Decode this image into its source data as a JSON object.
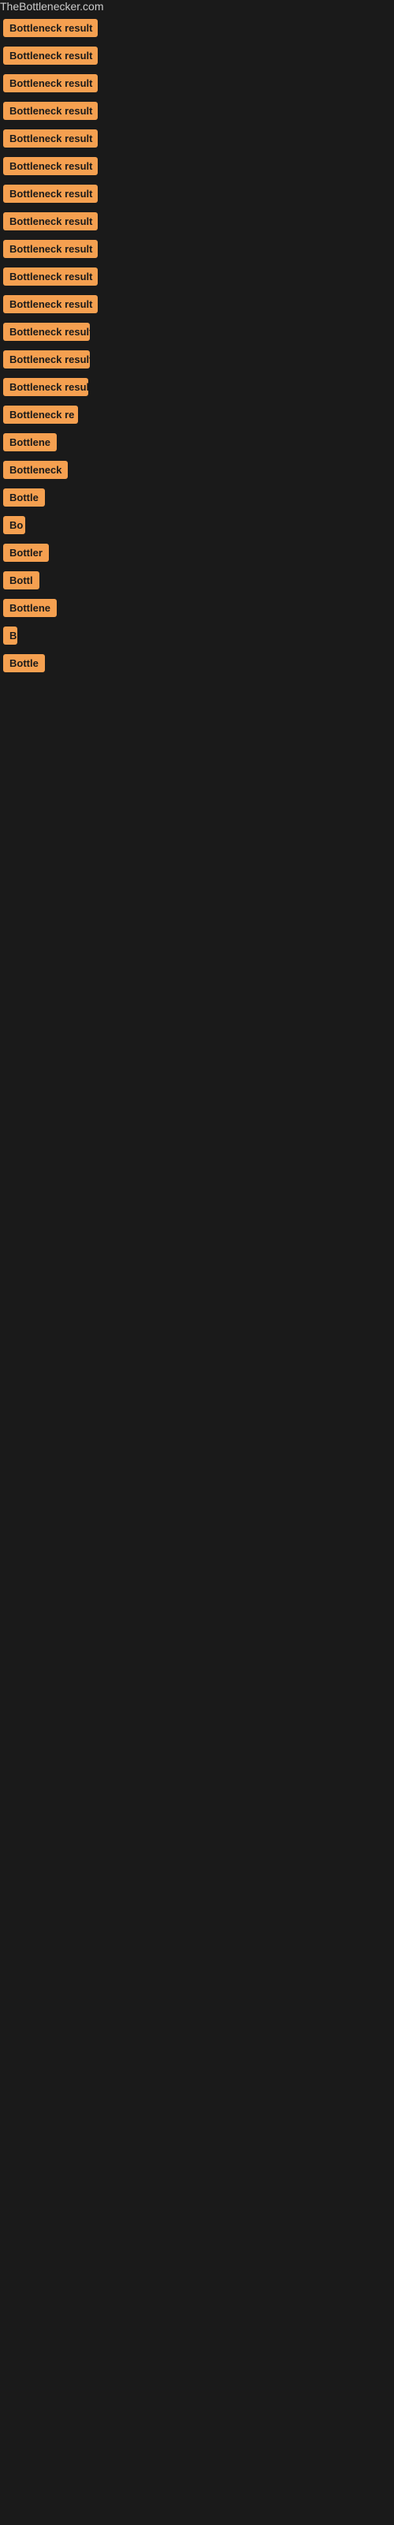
{
  "site": {
    "title": "TheBottlenecker.com"
  },
  "results": [
    {
      "id": 1,
      "label": "Bottleneck result",
      "width": 120
    },
    {
      "id": 2,
      "label": "Bottleneck result",
      "width": 120
    },
    {
      "id": 3,
      "label": "Bottleneck result",
      "width": 120
    },
    {
      "id": 4,
      "label": "Bottleneck result",
      "width": 120
    },
    {
      "id": 5,
      "label": "Bottleneck result",
      "width": 120
    },
    {
      "id": 6,
      "label": "Bottleneck result",
      "width": 120
    },
    {
      "id": 7,
      "label": "Bottleneck result",
      "width": 120
    },
    {
      "id": 8,
      "label": "Bottleneck result",
      "width": 120
    },
    {
      "id": 9,
      "label": "Bottleneck result",
      "width": 120
    },
    {
      "id": 10,
      "label": "Bottleneck result",
      "width": 120
    },
    {
      "id": 11,
      "label": "Bottleneck result",
      "width": 120
    },
    {
      "id": 12,
      "label": "Bottleneck result",
      "width": 110
    },
    {
      "id": 13,
      "label": "Bottleneck result",
      "width": 110
    },
    {
      "id": 14,
      "label": "Bottleneck result",
      "width": 108
    },
    {
      "id": 15,
      "label": "Bottleneck re",
      "width": 95
    },
    {
      "id": 16,
      "label": "Bottlene",
      "width": 75
    },
    {
      "id": 17,
      "label": "Bottleneck",
      "width": 82
    },
    {
      "id": 18,
      "label": "Bottle",
      "width": 60
    },
    {
      "id": 19,
      "label": "Bo",
      "width": 28
    },
    {
      "id": 20,
      "label": "Bottler",
      "width": 58
    },
    {
      "id": 21,
      "label": "Bottl",
      "width": 48
    },
    {
      "id": 22,
      "label": "Bottlene",
      "width": 68
    },
    {
      "id": 23,
      "label": "B",
      "width": 18
    },
    {
      "id": 24,
      "label": "Bottle",
      "width": 58
    }
  ]
}
